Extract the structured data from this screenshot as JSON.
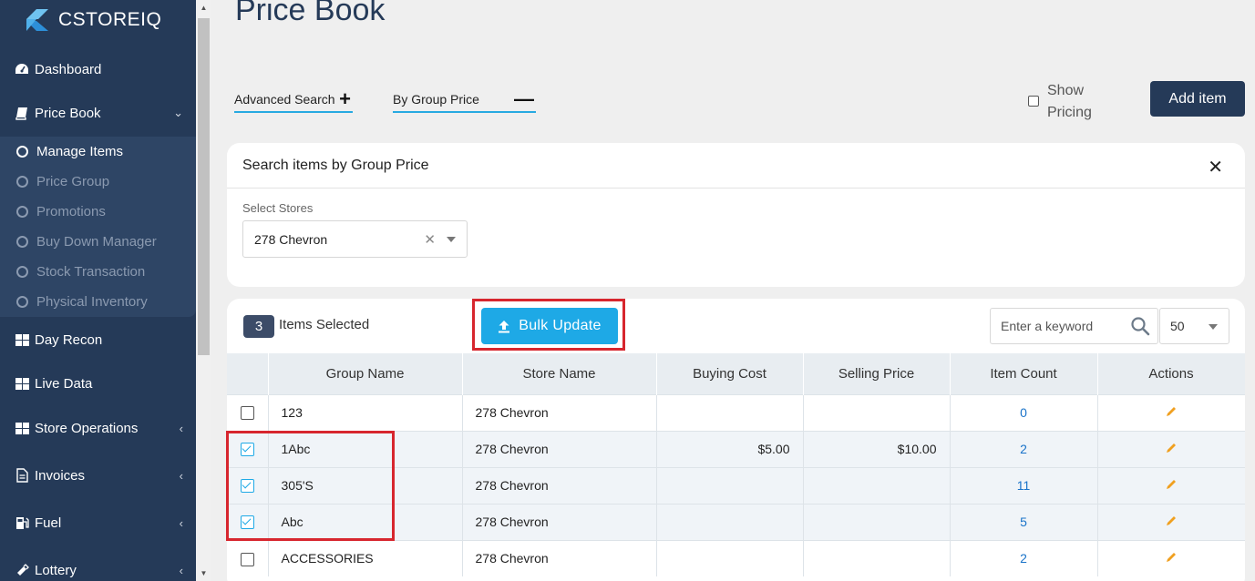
{
  "brand": {
    "name": "CSTOREIQ"
  },
  "sidebar": {
    "items": [
      {
        "label": "Dashboard",
        "icon": "dashboard-icon"
      },
      {
        "label": "Price Book",
        "icon": "book-icon"
      },
      {
        "label": "Day Recon",
        "icon": "grid-icon"
      },
      {
        "label": "Live Data",
        "icon": "grid-icon"
      },
      {
        "label": "Store Operations",
        "icon": "grid-icon"
      },
      {
        "label": "Invoices",
        "icon": "document-icon"
      },
      {
        "label": "Fuel",
        "icon": "fuel-icon"
      },
      {
        "label": "Lottery",
        "icon": "ticket-icon"
      }
    ],
    "submenu": [
      {
        "label": "Manage Items",
        "active": true
      },
      {
        "label": "Price Group"
      },
      {
        "label": "Promotions"
      },
      {
        "label": "Buy Down Manager"
      },
      {
        "label": "Stock Transaction"
      },
      {
        "label": "Physical Inventory"
      }
    ]
  },
  "page": {
    "title": "Price Book",
    "advanced_search": "Advanced Search",
    "by_group_price": "By Group Price",
    "show_pricing": "Show\nPricing",
    "show_pricing_line1": "Show",
    "show_pricing_line2": "Pricing",
    "add_item": "Add item"
  },
  "search_panel": {
    "title": "Search items by Group Price",
    "select_label": "Select Stores",
    "selected_store": "278 Chevron"
  },
  "table_toolbar": {
    "selected_count": "3",
    "selected_text": "Items Selected",
    "bulk_update": "Bulk Update",
    "keyword_placeholder": "Enter a keyword",
    "per_page": "50"
  },
  "table": {
    "columns": [
      "Group Name",
      "Store Name",
      "Buying Cost",
      "Selling Price",
      "Item Count",
      "Actions"
    ],
    "rows": [
      {
        "checked": false,
        "group": "123",
        "store": "278 Chevron",
        "buying": "",
        "selling": "",
        "count": "0"
      },
      {
        "checked": true,
        "group": "1Abc",
        "store": "278 Chevron",
        "buying": "$5.00",
        "selling": "$10.00",
        "count": "2"
      },
      {
        "checked": true,
        "group": "305'S",
        "store": "278 Chevron",
        "buying": "",
        "selling": "",
        "count": "11"
      },
      {
        "checked": true,
        "group": "Abc",
        "store": "278 Chevron",
        "buying": "",
        "selling": "",
        "count": "5"
      },
      {
        "checked": false,
        "group": "ACCESSORIES",
        "store": "278 Chevron",
        "buying": "",
        "selling": "",
        "count": "2"
      }
    ]
  },
  "colors": {
    "sidebar_bg": "#253a58",
    "accent": "#1ea9e6",
    "highlight": "#d7262e",
    "edit_icon": "#f0a020"
  }
}
